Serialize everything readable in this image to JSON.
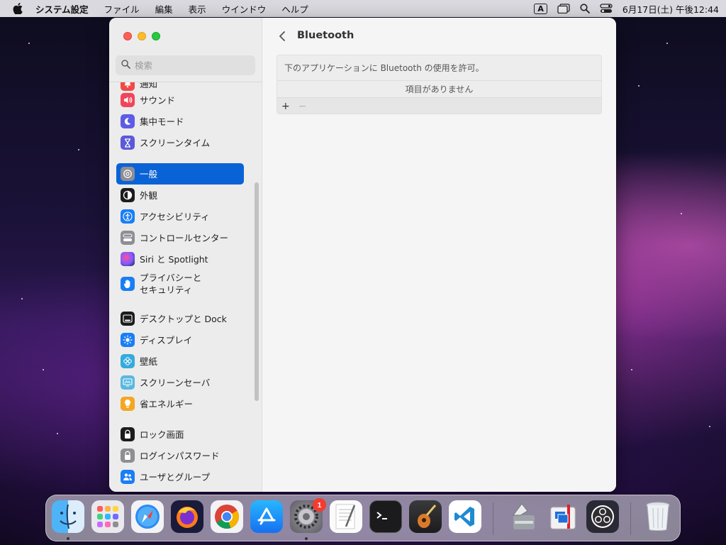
{
  "menubar": {
    "app_name": "システム設定",
    "menus": [
      "ファイル",
      "編集",
      "表示",
      "ウインドウ",
      "ヘルプ"
    ],
    "input_mode": "A",
    "datetime": "6月17日(土) 午後12:44"
  },
  "window": {
    "search_placeholder": "検索",
    "sidebar": {
      "items": [
        {
          "label": "通知",
          "icon": "bell-icon",
          "color": "#f24a45"
        },
        {
          "label": "サウンド",
          "icon": "speaker-icon",
          "color": "#f0455a"
        },
        {
          "label": "集中モード",
          "icon": "moon-icon",
          "color": "#5d5ce6"
        },
        {
          "label": "スクリーンタイム",
          "icon": "hourglass-icon",
          "color": "#5b5ad8"
        },
        {
          "label": "一般",
          "icon": "gear-icon",
          "color": "#8e8e93",
          "selected": true
        },
        {
          "label": "外観",
          "icon": "appearance-icon",
          "color": "#1c1c1e"
        },
        {
          "label": "アクセシビリティ",
          "icon": "accessibility-icon",
          "color": "#1a7ef5"
        },
        {
          "label": "コントロールセンター",
          "icon": "toggles-icon",
          "color": "#8e8e93"
        },
        {
          "label": "Siri と Spotlight",
          "icon": "siri-icon",
          "color": "#3a2d7a"
        },
        {
          "label": "プライバシーと\nセキュリティ",
          "icon": "hand-icon",
          "color": "#1a7ef5"
        },
        {
          "label": "デスクトップと Dock",
          "icon": "dock-icon",
          "color": "#1c1c1e"
        },
        {
          "label": "ディスプレイ",
          "icon": "sun-icon",
          "color": "#1a7ef5"
        },
        {
          "label": "壁紙",
          "icon": "flower-icon",
          "color": "#35aadc"
        },
        {
          "label": "スクリーンセーバ",
          "icon": "screensaver-icon",
          "color": "#5ab8e0"
        },
        {
          "label": "省エネルギー",
          "icon": "bulb-icon",
          "color": "#f5a623"
        },
        {
          "label": "ロック画面",
          "icon": "lock-icon",
          "color": "#1c1c1e"
        },
        {
          "label": "ログインパスワード",
          "icon": "lock-gray-icon",
          "color": "#8e8e93"
        },
        {
          "label": "ユーザとグループ",
          "icon": "users-icon",
          "color": "#1a7ef5"
        }
      ]
    },
    "content": {
      "title": "Bluetooth",
      "description": "下のアプリケーションに Bluetooth の使用を許可。",
      "empty_text": "項目がありません",
      "add_label": "+",
      "remove_label": "−"
    }
  },
  "dock": {
    "apps": [
      {
        "name": "finder",
        "running": true
      },
      {
        "name": "launchpad"
      },
      {
        "name": "safari"
      },
      {
        "name": "firefox"
      },
      {
        "name": "chrome"
      },
      {
        "name": "app-store"
      },
      {
        "name": "system-settings",
        "running": true,
        "badge": "1"
      },
      {
        "name": "textedit"
      },
      {
        "name": "terminal"
      },
      {
        "name": "garageband"
      },
      {
        "name": "vscode"
      },
      {
        "name": "disk-utility"
      },
      {
        "name": "parallels"
      },
      {
        "name": "obs"
      },
      {
        "name": "trash"
      }
    ]
  }
}
